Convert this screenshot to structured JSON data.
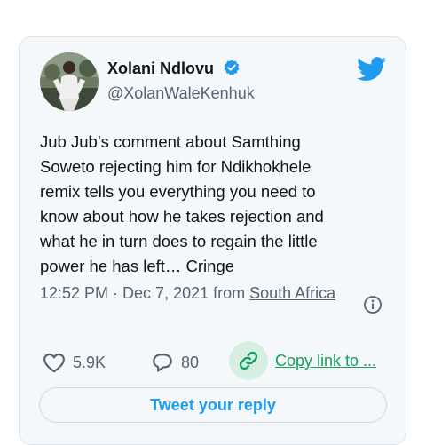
{
  "author": {
    "name": "Xolani Ndlovu",
    "handle": "@XolanWaleKenhuk"
  },
  "tweet": {
    "lines": [
      "Jub Jub’s comment about Samthing",
      "Soweto rejecting him for Ndikhokhele",
      "remix tells you everything you need to",
      "know about how he takes rejection and",
      "what he in turn does to regain the little",
      "power he has left… Cringe"
    ]
  },
  "meta": {
    "time_date_prefix": "12:52 PM · Dec 7, 2021 from ",
    "location_link": "South Africa"
  },
  "actions": {
    "likes": "5.9K",
    "replies": "80",
    "copy_link": "Copy link to ..."
  },
  "reply_button": "Tweet your reply",
  "colors": {
    "brand_blue": "#1d9bf0",
    "copy_green": "#17a05d",
    "card_bg": "#f5f8fa"
  }
}
